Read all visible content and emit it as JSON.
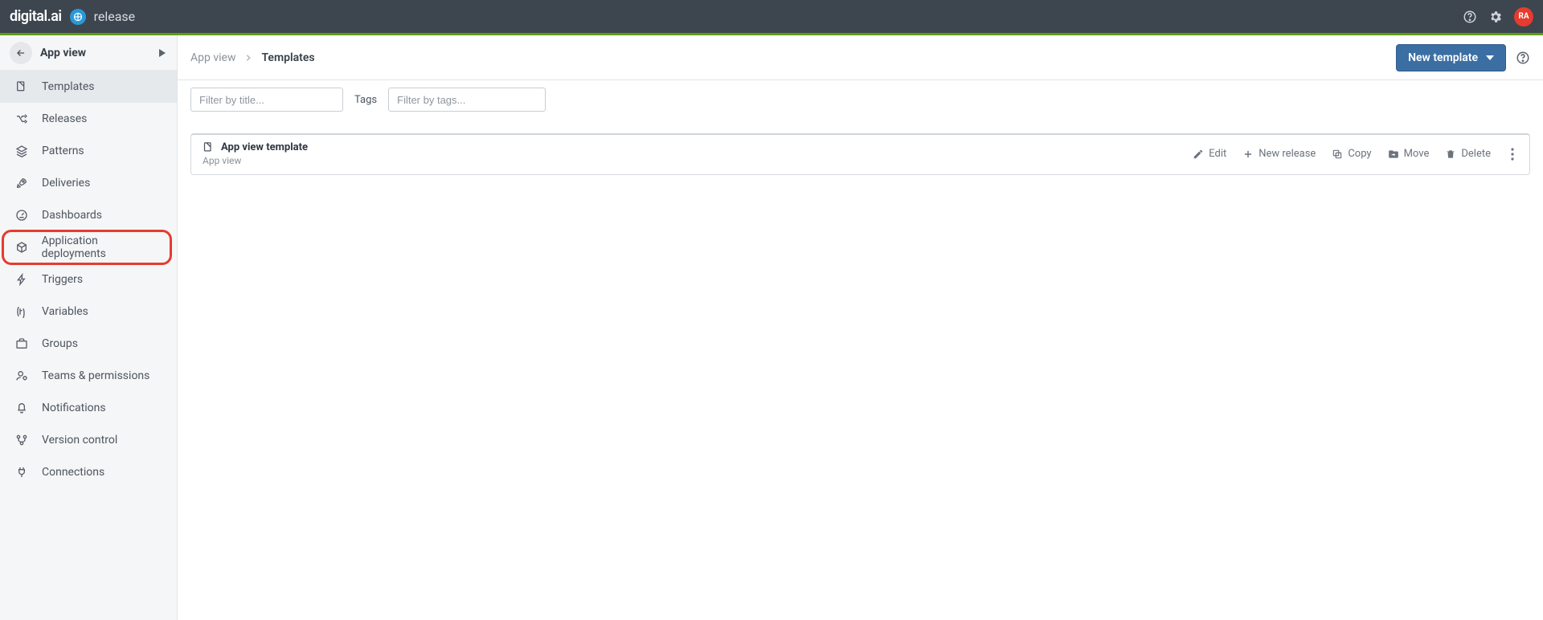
{
  "brand": {
    "name": "digital.ai",
    "product": "release"
  },
  "topbar": {
    "avatar": "RA"
  },
  "sidebar": {
    "title": "App view",
    "items": [
      {
        "label": "Templates"
      },
      {
        "label": "Releases"
      },
      {
        "label": "Patterns"
      },
      {
        "label": "Deliveries"
      },
      {
        "label": "Dashboards"
      },
      {
        "label": "Application deployments"
      },
      {
        "label": "Triggers"
      },
      {
        "label": "Variables"
      },
      {
        "label": "Groups"
      },
      {
        "label": "Teams & permissions"
      },
      {
        "label": "Notifications"
      },
      {
        "label": "Version control"
      },
      {
        "label": "Connections"
      }
    ]
  },
  "breadcrumb": {
    "parent": "App view",
    "current": "Templates"
  },
  "actions": {
    "new_template": "New template"
  },
  "filters": {
    "title_placeholder": "Filter by title...",
    "tags_label": "Tags",
    "tags_placeholder": "Filter by tags..."
  },
  "template": {
    "title": "App view template",
    "folder": "App view",
    "actions": {
      "edit": "Edit",
      "new_release": "New release",
      "copy": "Copy",
      "move": "Move",
      "delete": "Delete"
    }
  }
}
